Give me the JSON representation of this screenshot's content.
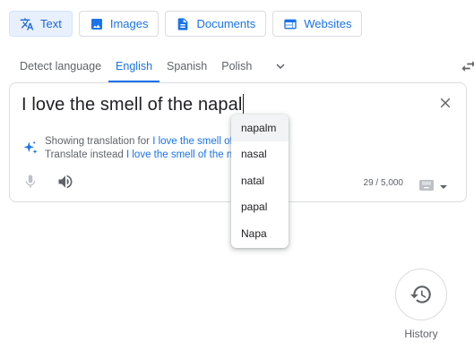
{
  "modes": [
    {
      "label": "Text",
      "icon": "translate-icon",
      "active": true
    },
    {
      "label": "Images",
      "icon": "image-icon"
    },
    {
      "label": "Documents",
      "icon": "document-icon"
    },
    {
      "label": "Websites",
      "icon": "website-icon"
    }
  ],
  "languages": {
    "tabs": [
      "Detect language",
      "English",
      "Spanish",
      "Polish"
    ],
    "active": "English"
  },
  "input": {
    "text": "I love the smell of the napal",
    "char_count": "29 / 5,000"
  },
  "suggestion": {
    "showing_prefix": "Showing translation for ",
    "showing_link": "I love the smell of",
    "instead_prefix": "Translate instead ",
    "instead_link": "I love the smell of the na"
  },
  "autocomplete": [
    "napalm",
    "nasal",
    "natal",
    "papal",
    "Napa"
  ],
  "history": {
    "label": "History"
  },
  "colors": {
    "accent": "#1a73e8",
    "active_bg": "#e8f0fe"
  }
}
